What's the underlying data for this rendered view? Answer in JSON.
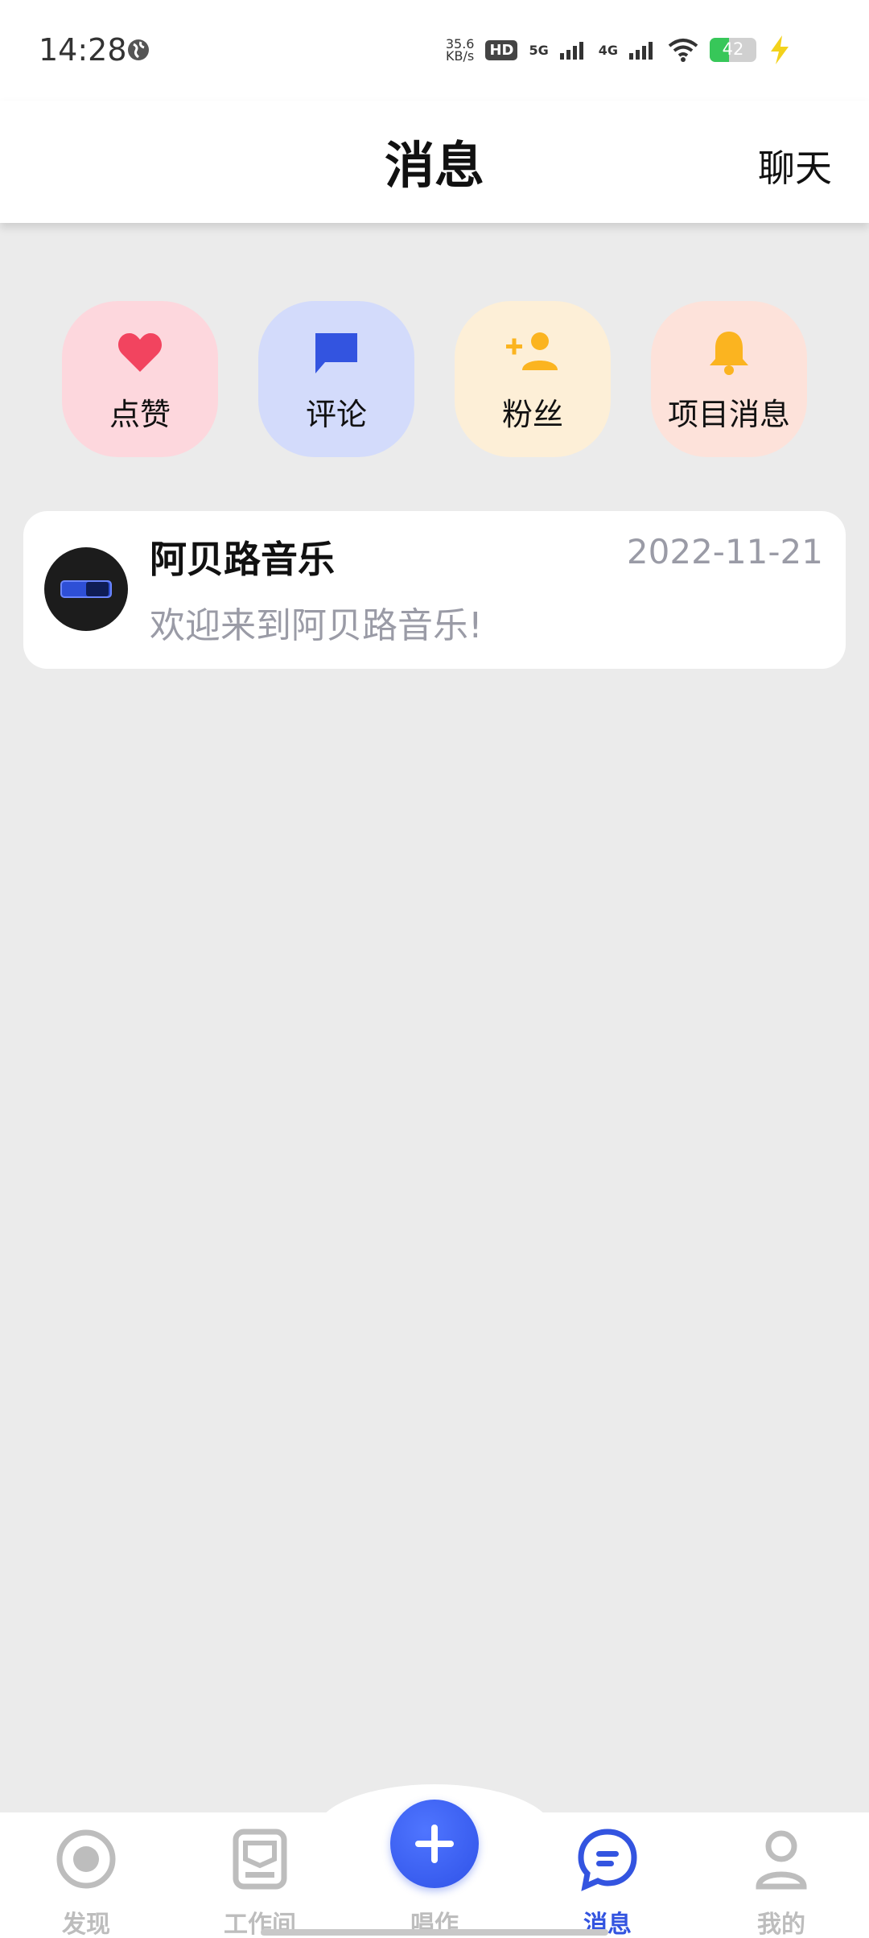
{
  "status_bar": {
    "time": "14:28",
    "net_speed": "35.6",
    "net_speed_unit": "KB/s",
    "hd_label": "HD",
    "sim1_label": "5G",
    "sim2_label": "4G",
    "battery_level": "42",
    "battery_percent": 42,
    "charging": true
  },
  "header": {
    "title": "消息",
    "chat_label": "聊天"
  },
  "categories": [
    {
      "label": "点赞",
      "icon": "heart-icon",
      "bg": "#fdd7dd",
      "color": "#f2445f"
    },
    {
      "label": "评论",
      "icon": "comment-icon",
      "bg": "#d3dbfb",
      "color": "#3354e0"
    },
    {
      "label": "粉丝",
      "icon": "add-user-icon",
      "bg": "#fdefd7",
      "color": "#fbb420"
    },
    {
      "label": "项目消息",
      "icon": "bell-icon",
      "bg": "#fde2da",
      "color": "#fbb420"
    }
  ],
  "messages": [
    {
      "name": "阿贝路音乐",
      "date": "2022-11-21",
      "preview": "欢迎来到阿贝路音乐!"
    }
  ],
  "bottom_nav": {
    "items": [
      {
        "label": "发现",
        "icon": "discover-icon",
        "active": false
      },
      {
        "label": "工作间",
        "icon": "workspace-icon",
        "active": false
      },
      {
        "label": "唱作",
        "icon": "plus-icon",
        "active": false
      },
      {
        "label": "消息",
        "icon": "message-icon",
        "active": true
      },
      {
        "label": "我的",
        "icon": "profile-icon",
        "active": false
      }
    ],
    "active_color": "#3354e0",
    "inactive_color": "#bdbdbd"
  }
}
